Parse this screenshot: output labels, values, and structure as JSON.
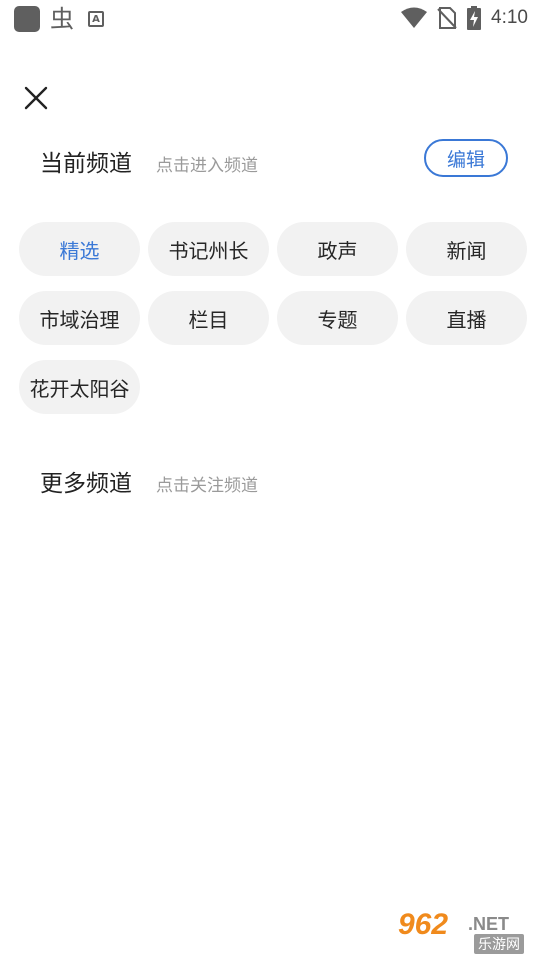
{
  "status_bar": {
    "time": "4:10",
    "icons": [
      "app-icon",
      "bug-icon",
      "a-badge-icon",
      "wifi-icon",
      "no-sim-icon",
      "battery-charging-icon"
    ]
  },
  "header": {
    "close_icon": "close-icon"
  },
  "current_channels": {
    "title": "当前频道",
    "hint": "点击进入频道",
    "edit_label": "编辑",
    "selected": "精选",
    "items": [
      "精选",
      "书记州长",
      "政声",
      "新闻",
      "市域治理",
      "栏目",
      "专题",
      "直播",
      "花开太阳谷"
    ]
  },
  "more_channels": {
    "title": "更多频道",
    "hint": "点击关注频道"
  },
  "watermark": {
    "number": "962",
    "domain": ".NET",
    "cn": "乐游网"
  },
  "colors": {
    "accent": "#3a78d6",
    "chip_bg": "#f2f2f2",
    "hint": "#9a9a9a"
  }
}
